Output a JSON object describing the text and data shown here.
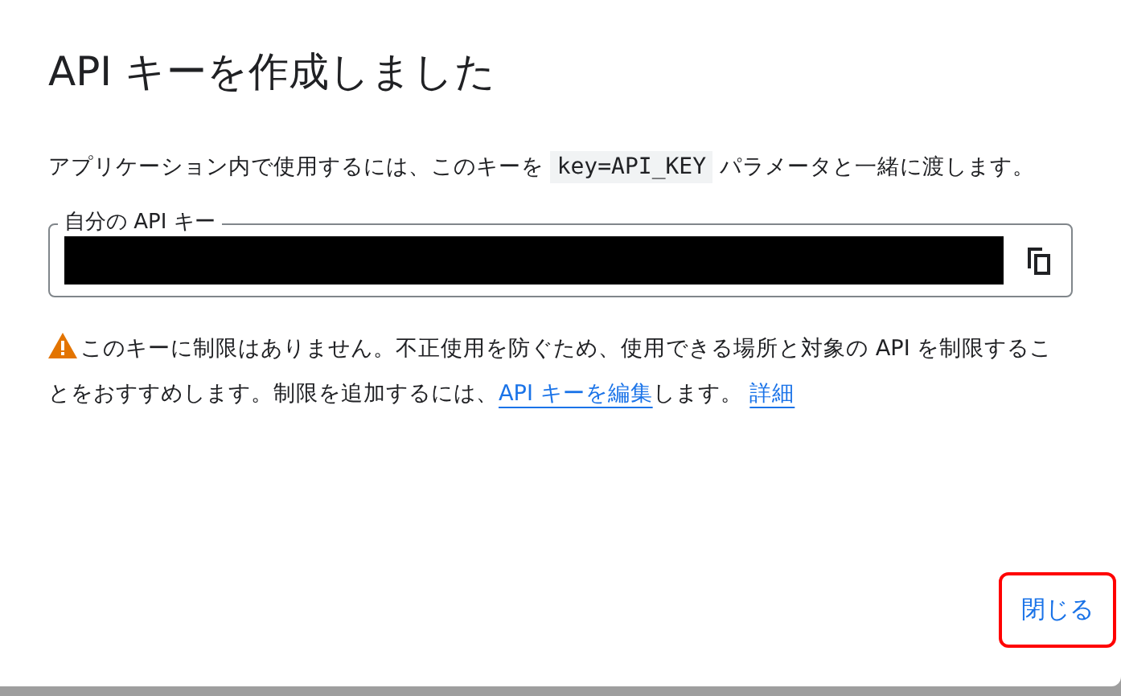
{
  "dialog": {
    "title": "API キーを作成しました",
    "description": {
      "before": "アプリケーション内で使用するには、このキーを ",
      "code": "key=API_KEY",
      "after": " パラメータと一緒に渡します。"
    },
    "key_field": {
      "label": "自分の API キー"
    },
    "warning": {
      "text": "このキーに制限はありません。不正使用を防ぐため、使用できる場所と対象の API を制限することをおすすめします。制限を追加するには、",
      "link": "API キーを編集",
      "after": "します。",
      "learn_more": "詳細"
    },
    "close_button": "閉じる"
  }
}
